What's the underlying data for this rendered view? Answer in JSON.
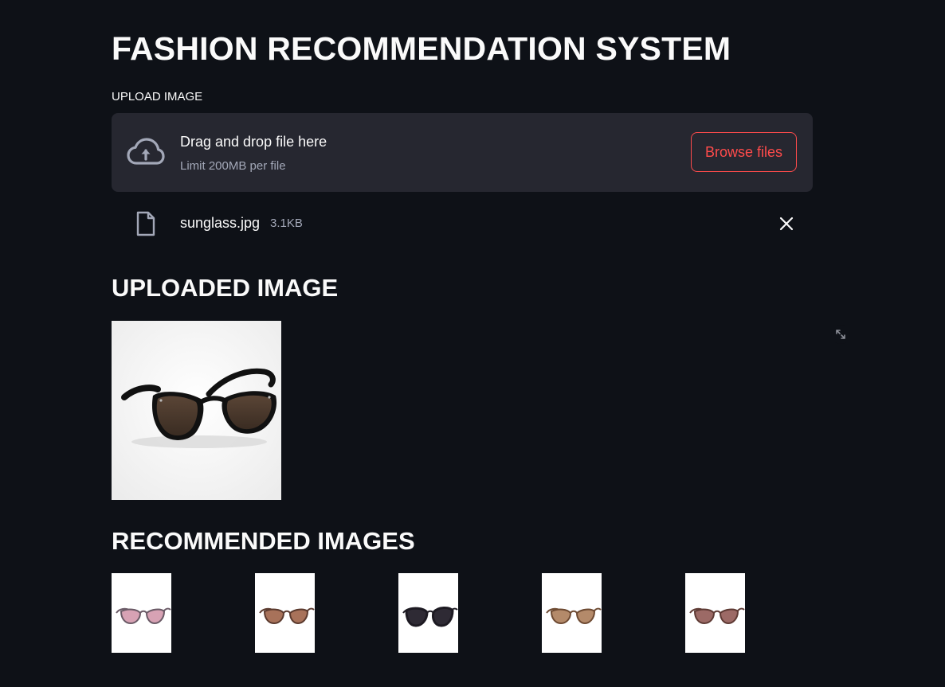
{
  "page": {
    "title": "FASHION RECOMMENDATION SYSTEM"
  },
  "uploader": {
    "label": "UPLOAD IMAGE",
    "drop_text": "Drag and drop file here",
    "limit_text": "Limit 200MB per file",
    "browse_label": "Browse files",
    "icons": {
      "dropzone": "cloud-upload-icon",
      "file": "file-icon",
      "remove": "close-icon"
    }
  },
  "uploaded_file": {
    "name": "sunglass.jpg",
    "size": "3.1KB"
  },
  "sections": {
    "uploaded_title": "UPLOADED IMAGE",
    "recommended_title": "RECOMMENDED IMAGES"
  },
  "uploaded_image": {
    "description_icon": "sunglasses-image",
    "lens_color": "#4a3a2e",
    "frame_color": "#111111"
  },
  "recommendations": [
    {
      "icon": "sunglasses-image",
      "frame_color": "#6a5a66",
      "lens_color": "#d7a2b4"
    },
    {
      "icon": "sunglasses-image",
      "frame_color": "#5b3a2e",
      "lens_color": "#a8725a"
    },
    {
      "icon": "sunglasses-image",
      "frame_color": "#1d1a22",
      "lens_color": "#2e2a34"
    },
    {
      "icon": "sunglasses-image",
      "frame_color": "#6e4a32",
      "lens_color": "#b48a6a"
    },
    {
      "icon": "sunglasses-image",
      "frame_color": "#5e3a34",
      "lens_color": "#9c6a66"
    }
  ],
  "colors": {
    "background": "#0e1117",
    "dropzone": "#262730",
    "accent": "#ff4b4b",
    "muted_text": "#a3a8b8"
  }
}
